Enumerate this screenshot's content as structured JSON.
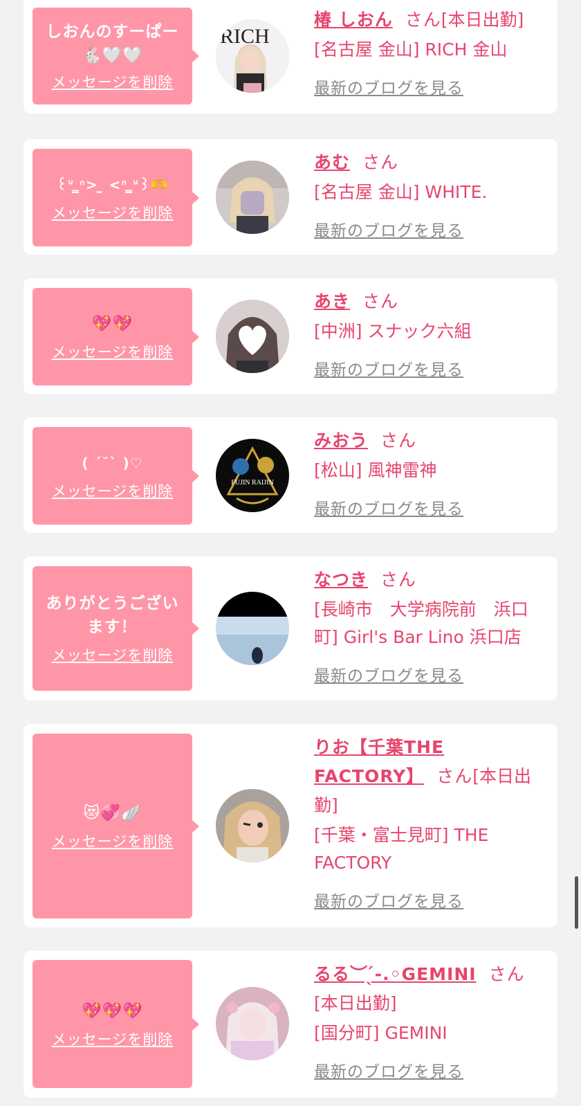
{
  "delete_label": "メッセージを削除",
  "blog_label": "最新のブログを見る",
  "san_label": "さん",
  "colors": {
    "bubble": "#ff96a8",
    "accent": "#e6456d",
    "link_gray": "#8a8a8a",
    "background": "#f2f2f2"
  },
  "cards": [
    {
      "message": "しおんのすーぱー🐇🤍🤍",
      "name": "椿 しおん",
      "tag": "[本日出勤]",
      "shop": "[名古屋 金山] RICH 金山",
      "avatar": "avatar-magazine-cover"
    },
    {
      "message": "꒰ᐡ ̳ᐢ> ̫ <ᐢ ̳ᐡ꒱🫶",
      "name": "あむ",
      "tag": "",
      "shop": "[名古屋 金山] WHITE.",
      "avatar": "avatar-blurred-photo"
    },
    {
      "message": "💖💖",
      "name": "あき",
      "tag": "",
      "shop": "[中洲] スナック六組",
      "avatar": "avatar-heart-covered-face"
    },
    {
      "message": "( ´˘` )♡",
      "name": "みおう",
      "tag": "",
      "shop": "[松山] 風神雷神",
      "avatar": "avatar-fujin-raijin-logo",
      "avatar_text": "FUJIN RAIJIN"
    },
    {
      "message": "ありがとうございます！",
      "name": "なつき",
      "tag": "",
      "shop": "[長崎市　大学病院前　浜口町] Girl's Bar Lino 浜口店",
      "avatar": "avatar-seaside-photo"
    },
    {
      "message": "😻💞🪽",
      "name": "りお【千葉THE FACTORY】",
      "tag": "[本日出勤]",
      "shop": "[千葉・富士見町] THE FACTORY",
      "avatar": "avatar-wink-selfie"
    },
    {
      "message": "💖💖💖",
      "name": "るる︶ ̖́-.◦GEMINI",
      "tag": "[本日出勤]",
      "shop": "[国分町] GEMINI",
      "avatar": "avatar-pink-doll-photo"
    }
  ]
}
